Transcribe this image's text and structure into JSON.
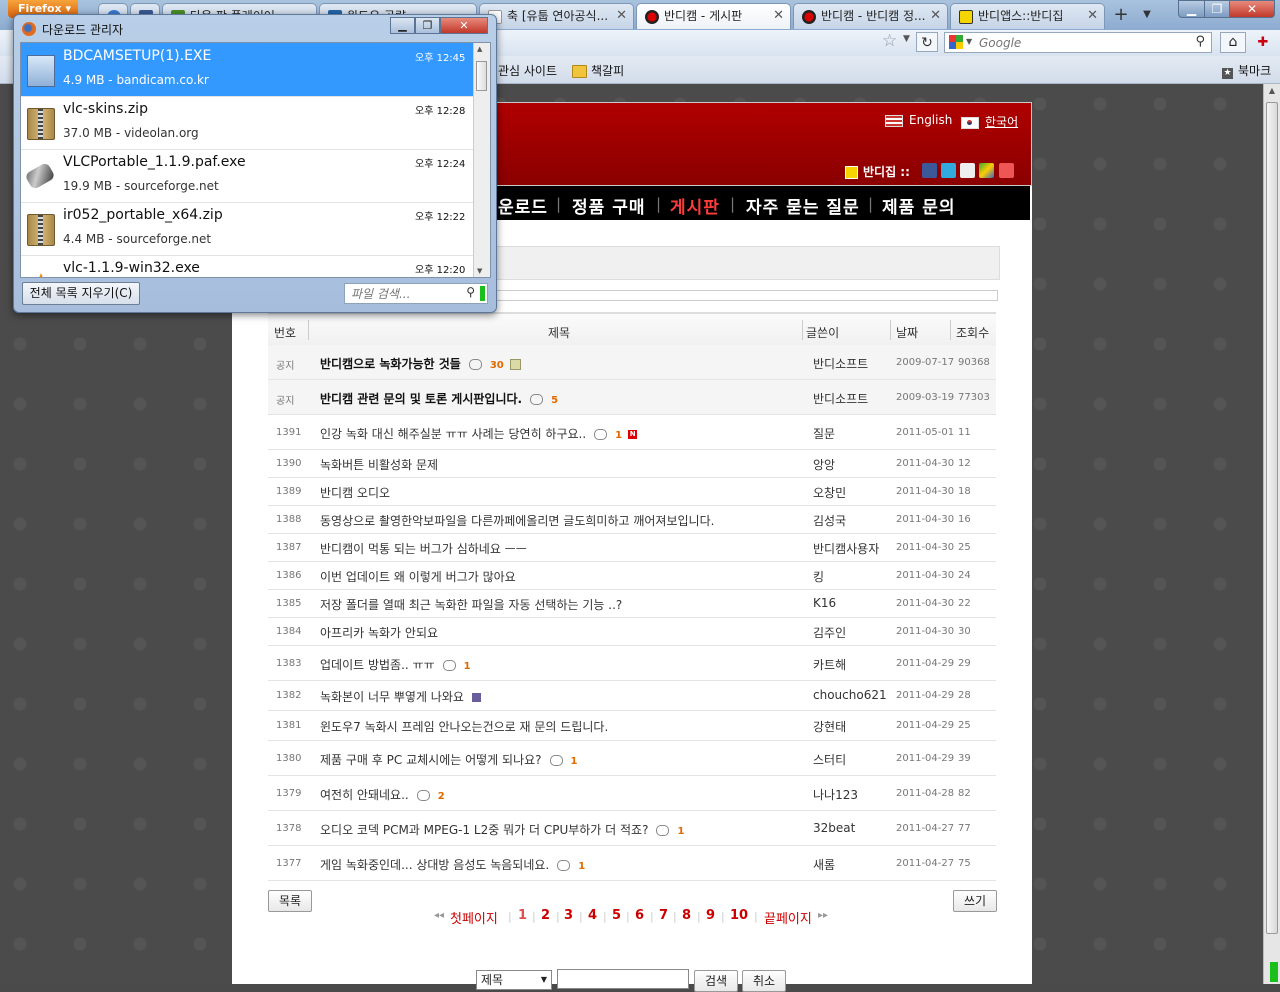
{
  "browser": {
    "firefox_button": "Firefox",
    "tabs": [
      {
        "label": "",
        "color": "#3a7bd5"
      },
      {
        "label": "",
        "color": "#3b5998"
      },
      {
        "label": "다음 팟 플레이어",
        "color": "#4a8f2a"
      },
      {
        "label": "윈도우 공략",
        "color": "#2266aa"
      },
      {
        "label": "축 [유툽 연아공식...",
        "color": "#ffffff"
      },
      {
        "label": "반디캠 - 게시판",
        "color": "#d00000"
      },
      {
        "label": "반디캠 - 반디캠 정...",
        "color": "#d00000"
      },
      {
        "label": "반디앱스::반디집",
        "color": "#f5d400"
      }
    ],
    "search_placeholder": "Google",
    "bookmarks": [
      {
        "label": "관심 사이트"
      },
      {
        "label": "책갈피"
      }
    ],
    "bookmarks_menu": "북마크"
  },
  "download_manager": {
    "title": "다운로드 관리자",
    "items": [
      {
        "name": "BDCAMSETUP(1).EXE",
        "meta": "4.9 MB - bandicam.co.kr",
        "time": "오후 12:45",
        "icon": "installer-icon",
        "selected": true
      },
      {
        "name": "vlc-skins.zip",
        "meta": "37.0 MB - videolan.org",
        "time": "오후 12:28",
        "icon": "zip-icon",
        "selected": false
      },
      {
        "name": "VLCPortable_1.1.9.paf.exe",
        "meta": "19.9 MB - sourceforge.net",
        "time": "오후 12:24",
        "icon": "usb-icon",
        "selected": false
      },
      {
        "name": "ir052_portable_x64.zip",
        "meta": "4.4 MB - sourceforge.net",
        "time": "오후 12:22",
        "icon": "zip-icon",
        "selected": false
      },
      {
        "name": "vlc-1.1.9-win32.exe",
        "meta": "",
        "time": "오후 12:20",
        "icon": "vlc-cone-icon",
        "selected": false
      }
    ],
    "clear_button": "전체 목록 지우기(C)",
    "search_placeholder": "파일 검색..."
  },
  "site": {
    "lang_en": "English",
    "lang_ko": "한국어",
    "bandizip": "반디집 ::",
    "menu": [
      {
        "label": "운로드",
        "active": false
      },
      {
        "label": "정품 구매",
        "active": false
      },
      {
        "label": "게시판",
        "active": true
      },
      {
        "label": "자주 묻는 질문",
        "active": false
      },
      {
        "label": "제품 문의",
        "active": false
      }
    ],
    "board_headers": {
      "num": "번호",
      "title": "제목",
      "author": "글쓴이",
      "date": "날짜",
      "views": "조회수"
    },
    "rows": [
      {
        "num": "공지",
        "title": "반디캠으로 녹화가능한 것들",
        "comments": "30",
        "extra": "file",
        "author": "반디소프트",
        "date": "2009-07-17",
        "views": "90368",
        "notice": true
      },
      {
        "num": "공지",
        "title": "반디캠 관련 문의 및 토론 게시판입니다.",
        "comments": "5",
        "extra": "",
        "author": "반디소프트",
        "date": "2009-03-19",
        "views": "77303",
        "notice": true
      },
      {
        "num": "1391",
        "title": "인강 녹화 대신 해주실분 ㅠㅠ 사례는 당연히 하구요..",
        "comments": "1",
        "extra": "new",
        "author": "질문",
        "date": "2011-05-01",
        "views": "11",
        "notice": false
      },
      {
        "num": "1390",
        "title": "녹화버튼 비활성화 문제",
        "comments": "",
        "extra": "",
        "author": "앙앙",
        "date": "2011-04-30",
        "views": "12",
        "notice": false
      },
      {
        "num": "1389",
        "title": "반디캠 오디오",
        "comments": "",
        "extra": "",
        "author": "오창민",
        "date": "2011-04-30",
        "views": "18",
        "notice": false
      },
      {
        "num": "1388",
        "title": "동영상으로 촬영한악보파일을 다른까페에올리면 글도희미하고 깨어져보입니다.",
        "comments": "",
        "extra": "",
        "author": "김성국",
        "date": "2011-04-30",
        "views": "16",
        "notice": false
      },
      {
        "num": "1387",
        "title": "반디캠이 먹통 되는 버그가 심하네요 ㅡㅡ",
        "comments": "",
        "extra": "",
        "author": "반디캠사용자",
        "date": "2011-04-30",
        "views": "25",
        "notice": false
      },
      {
        "num": "1386",
        "title": "이번 업데이트 왜 이렇게 버그가 많아요",
        "comments": "",
        "extra": "",
        "author": "킹",
        "date": "2011-04-30",
        "views": "24",
        "notice": false
      },
      {
        "num": "1385",
        "title": "저장 폴더를 열때 최근 녹화한 파일을 자동 선택하는 기능 ..?",
        "comments": "",
        "extra": "",
        "author": "K16",
        "date": "2011-04-30",
        "views": "22",
        "notice": false
      },
      {
        "num": "1384",
        "title": "아프리카 녹화가 안되요",
        "comments": "",
        "extra": "",
        "author": "김주인",
        "date": "2011-04-30",
        "views": "30",
        "notice": false
      },
      {
        "num": "1383",
        "title": "업데이트 방법좀.. ㅠㅠ",
        "comments": "1",
        "extra": "",
        "author": "카트해",
        "date": "2011-04-29",
        "views": "29",
        "notice": false
      },
      {
        "num": "1382",
        "title": "녹화본이 너무 뿌옇게 나와요",
        "comments": "",
        "extra": "disk",
        "author": "choucho621",
        "date": "2011-04-29",
        "views": "28",
        "notice": false
      },
      {
        "num": "1381",
        "title": "윈도우7 녹화시 프레임 안나오는건으로 재 문의 드립니다.",
        "comments": "",
        "extra": "",
        "author": "강현태",
        "date": "2011-04-29",
        "views": "25",
        "notice": false
      },
      {
        "num": "1380",
        "title": "제품 구매 후 PC 교체시에는 어떻게 되나요?",
        "comments": "1",
        "extra": "",
        "author": "스터티",
        "date": "2011-04-29",
        "views": "39",
        "notice": false
      },
      {
        "num": "1379",
        "title": "여전히 안돼네요..",
        "comments": "2",
        "extra": "",
        "author": "나나123",
        "date": "2011-04-28",
        "views": "82",
        "notice": false
      },
      {
        "num": "1378",
        "title": "오디오 코덱 PCM과 MPEG-1 L2중 뭐가 더 CPU부하가 더 적죠?",
        "comments": "1",
        "extra": "",
        "author": "32beat",
        "date": "2011-04-27",
        "views": "77",
        "notice": false
      },
      {
        "num": "1377",
        "title": "게임 녹화중인데... 상대방 음성도 녹음되네요.",
        "comments": "1",
        "extra": "",
        "author": "새롬",
        "date": "2011-04-27",
        "views": "75",
        "notice": false
      }
    ],
    "list_button": "목록",
    "write_button": "쓰기",
    "pager": {
      "first": "첫페이지",
      "pages": [
        "1",
        "2",
        "3",
        "4",
        "5",
        "6",
        "7",
        "8",
        "9",
        "10"
      ],
      "last": "끝페이지"
    },
    "search_select": "제목",
    "search_button": "검색",
    "cancel_button": "취소"
  },
  "colors": {
    "header_red": "#a00000",
    "active_menu": "#ff3b3b",
    "selection_blue": "#3399ff",
    "comment_orange": "#e06a00"
  }
}
